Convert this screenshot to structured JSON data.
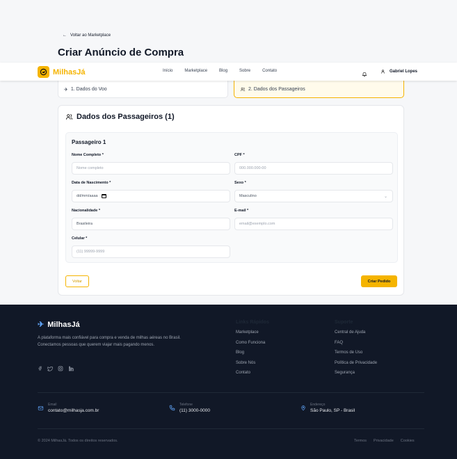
{
  "header": {
    "back_link": "Voltar ao Marketplace",
    "page_title": "Criar Anúncio de Compra"
  },
  "navbar": {
    "brand": "MilhasJá",
    "links": [
      "Início",
      "Marketplace",
      "Blog",
      "Sobre",
      "Contato"
    ],
    "user_name": "Gabriel Lopes",
    "icons": [
      "plane-icon",
      "bell-icon",
      "user-icon"
    ]
  },
  "steps": [
    {
      "label": "1. Dados do Voo",
      "active": false
    },
    {
      "label": "2. Dados dos Passageiros",
      "active": true
    }
  ],
  "form": {
    "title": "Dados dos Passageiros (1)",
    "passenger_title": "Passageiro 1",
    "fields": {
      "name": {
        "label": "Nome Completo *",
        "placeholder": "Nome completo"
      },
      "cpf": {
        "label": "CPF *",
        "placeholder": "000.000.000-00"
      },
      "birth": {
        "label": "Data de Nascimento *",
        "placeholder": "dd/mm/aaaa"
      },
      "sex": {
        "label": "Sexo *",
        "value": "Masculino"
      },
      "nationality": {
        "label": "Nacionalidade *",
        "value": "Brasileira"
      },
      "email": {
        "label": "E-mail *",
        "placeholder": "email@exemplo.com"
      },
      "phone": {
        "label": "Celular *",
        "placeholder": "(11) 99999-9999"
      }
    },
    "back_button": "Voltar",
    "submit_button": "Criar Pedido"
  },
  "footer": {
    "brand": "MilhasJá",
    "description": "A plataforma mais confiável para compra e venda de milhas aéreas no Brasil. Conectamos pessoas que querem viajar mais pagando menos.",
    "quick_links_title": "Links Rápidos",
    "quick_links": [
      "Marketplace",
      "Como Funciona",
      "Blog",
      "Sobre Nós",
      "Contato"
    ],
    "support_title": "Suporte",
    "support_links": [
      "Central de Ajuda",
      "FAQ",
      "Termos de Uso",
      "Política de Privacidade",
      "Segurança"
    ],
    "contact": {
      "email_label": "Email",
      "email": "contato@milhasja.com.br",
      "phone_label": "Telefone",
      "phone": "(11) 3000-0000",
      "address_label": "Endereço",
      "address": "São Paulo, SP - Brasil"
    },
    "copyright": "© 2024 MilhasJá. Todos os direitos reservados.",
    "legal": [
      "Termos",
      "Privacidade",
      "Cookies"
    ]
  },
  "colors": {
    "accent": "#f5b400",
    "footer_bg": "#111827"
  }
}
